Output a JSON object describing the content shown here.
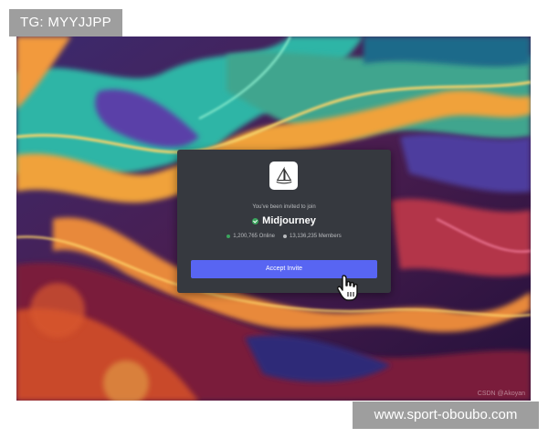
{
  "overlay_labels": {
    "top_left": "TG: MYYJJPP",
    "bottom_right": "www.sport-oboubo.com"
  },
  "invite": {
    "subtitle": "You've been invited to join",
    "server_name": "Midjourney",
    "online": "1,200,765 Online",
    "members": "13,136,235 Members",
    "accept_label": "Accept Invite"
  },
  "watermark": "CSDN @Akoyan",
  "colors": {
    "card_bg": "#36393f",
    "accept_button": "#5865f2",
    "online_dot": "#3ba55d",
    "members_dot": "#b9bbbe"
  },
  "icons": {
    "server": "midjourney-sailboat-icon",
    "verified": "verified-check-icon",
    "cursor": "hand-pointer-cursor-icon"
  }
}
